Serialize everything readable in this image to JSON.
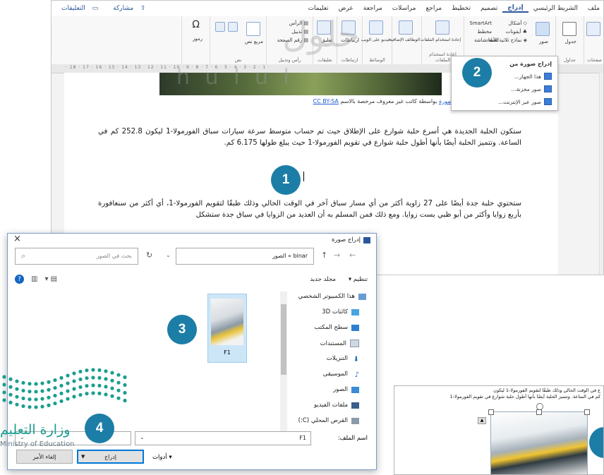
{
  "word": {
    "tabs": [
      "ملف",
      "الشريط الرئيسي",
      "إدراج",
      "تصميم",
      "تخطيط",
      "مراجع",
      "مراسلات",
      "مراجعة",
      "عرض",
      "تعليمات"
    ],
    "active_tab": "إدراج",
    "share": "مشاركة",
    "comments": "التعليقات",
    "ribbon": {
      "g_pages": "صفحات",
      "g_tables": "جداول",
      "table": "جدول",
      "pics": "صور",
      "shapes": "أشكال",
      "icons": "أيقونات",
      "models": "نماذج ثلاثية الأبعاد",
      "smartart": "SmartArt",
      "chart": "مخطط",
      "screenshot": "لقطة شاشة",
      "g_reuse": "إعادة استخدام الملفات",
      "reuse": "إعادة استخدام الملفات",
      "g_addins": "الوظائف الإضافية",
      "addins": "الوظائف الإضافية",
      "g_media": "الوسائط",
      "video": "فيديو على الويب",
      "g_links": "ارتباطات",
      "links": "ارتباطات",
      "g_comments": "تعليقات",
      "comment": "تعليق",
      "g_header": "رأس وتذييل",
      "header": "الرأس",
      "footer": "تذييل",
      "page_no": "رقم الصفحة",
      "g_text": "نص",
      "textbox": "مربع نص",
      "g_symbols": "رموز",
      "symbols": "رموز"
    },
    "ruler": "· 18 · 17 · 16 · 15 · 14 · 13 · 12 · 11 · 10 · 9 · 8 · 7 · 6 · 5 · 4 · 3 · 2 · 1 ·",
    "caption_before": "صورة",
    "caption_mid": " بواسطة كاتب غير معروف مرخصة بالاسم ",
    "caption_license": "CC BY-SA",
    "para1": "ستكون الحلبة الجديدة هي أسرع حلبة شوارع على الإطلاق حيث تم حساب متوسط سرعة سيارات سباق الفورمولا-1 ليكون 252.8 كم في الساعة. وتتميز الحلبة أيضًا بأنها أطول حلبة شوارع في تقويم الفورمولا-1 حيث يبلغ طولها 6.175 كم.",
    "para2": "ستحتوي حلبة جدة أيضًا على 27 زاوية أكثر من أي مسار سباق آخر في الوقت الحالي وذلك طبقًا لتقويم الفورمولا-1، أي أكثر من سنغافورة بأربع زوايا وأكثر من أبو ظبي بست زوايا. ومع ذلك فمن المسلم به أن العديد من الزوايا في سباق جدة ستشكل",
    "dropdown": {
      "header": "إدراج صورة من",
      "items": [
        "هذا الجهاز...",
        "صور مخزنة...",
        "صور عبر الإنترنت..."
      ]
    }
  },
  "badges": [
    "1",
    "2",
    "3",
    "4"
  ],
  "dialog": {
    "title": "إدراج صورة",
    "close": "×",
    "breadcrumb": "binar  »  الصور",
    "search_placeholder": "بحث في الصور",
    "organize": "تنظيم",
    "new_folder": "مجلد جديد",
    "nav": [
      "هذا الكمبيوتر الشخصي",
      "كائنات 3D",
      "سطح المكتب",
      "المستندات",
      "التنزيلات",
      "الموسيقى",
      "الصور",
      "ملفات الفيديو",
      "القرص المحلي (C:)"
    ],
    "file_name": "F1",
    "filename_label": "اسم الملف:",
    "filename_value": "F1",
    "tools": "أدوات",
    "insert": "إدراج",
    "cancel": "إلغاء الأمر"
  },
  "inset": {
    "text1": "ع في الوقت الحالي وذلك طبقًا لتقويم الفورمولا-1 ليكون",
    "text2": "كم في الساعة. وتتميز الحلبة أيضًا بأنها أطول حلبة شوارع في تقويم الفورمولا-1"
  },
  "logo": {
    "arabic": "وزارة التعليم",
    "english": "Ministry of Education"
  },
  "watermark": {
    "arabic": "حلول",
    "latin": "h u l u l"
  },
  "colors": {
    "badge": "#1c7ea6",
    "accent": "#2b579a",
    "logo_green": "#1a9d8f"
  }
}
